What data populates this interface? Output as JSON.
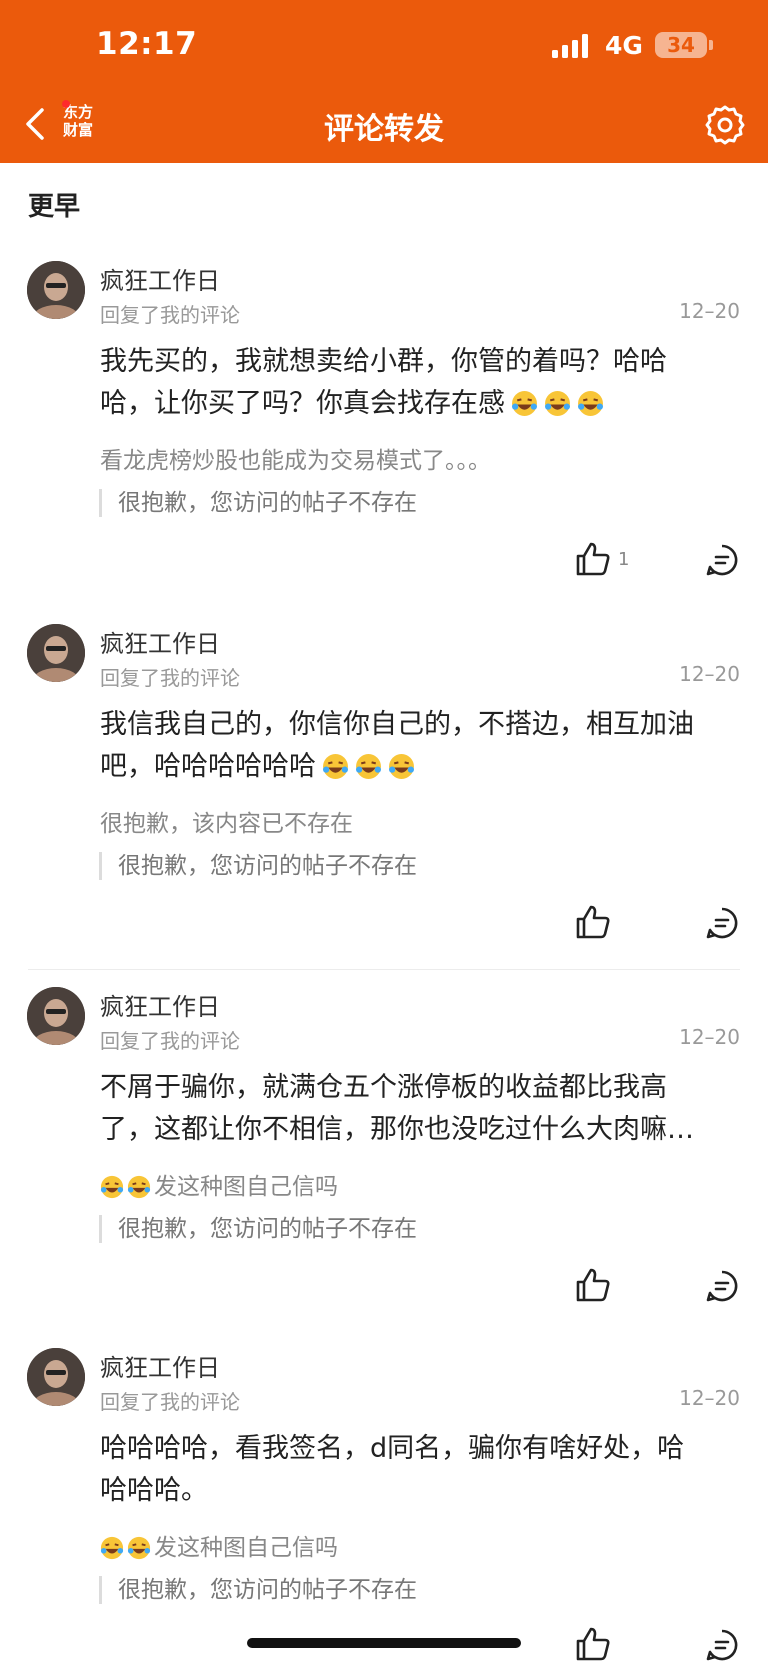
{
  "status_bar": {
    "time": "12:17",
    "network": "4G",
    "battery": "34"
  },
  "nav": {
    "title": "评论转发",
    "logo_line1": "东方",
    "logo_line2": "财富"
  },
  "section_title": "更早",
  "comments": [
    {
      "user": "疯狂工作日",
      "reply_label": "回复了我的评论",
      "date": "12–20",
      "text_line1": "我先买的，我就想卖给小群，你管的着吗？哈哈",
      "text_line2": "哈，让你买了吗？你真会找存在感",
      "original": "看龙虎榜炒股也能成为交易模式了。。。",
      "quote": "很抱歉，您访问的帖子不存在",
      "like_count": "1"
    },
    {
      "user": "疯狂工作日",
      "reply_label": "回复了我的评论",
      "date": "12–20",
      "text_line1": "我信我自己的，你信你自己的，不搭边，相互加油",
      "text_line2": "吧，哈哈哈哈哈哈",
      "original": "很抱歉，该内容已不存在",
      "quote": "很抱歉，您访问的帖子不存在",
      "like_count": ""
    },
    {
      "user": "疯狂工作日",
      "reply_label": "回复了我的评论",
      "date": "12–20",
      "text_line1": "不屑于骗你，就满仓五个涨停板的收益都比我高",
      "text_line2": "了，这都让你不相信，那你也没吃过什么大肉嘛…",
      "original": "发这种图自己信吗",
      "quote": "很抱歉，您访问的帖子不存在",
      "like_count": ""
    },
    {
      "user": "疯狂工作日",
      "reply_label": "回复了我的评论",
      "date": "12–20",
      "text_line1": "哈哈哈哈，看我签名，d同名，骗你有啥好处，哈",
      "text_line2": "哈哈哈。",
      "original": "发这种图自己信吗",
      "quote": "很抱歉，您访问的帖子不存在",
      "like_count": ""
    }
  ],
  "colors": {
    "brand": "#EB5A0C",
    "text": "#222222",
    "muted": "#999999"
  },
  "icons": [
    "back-icon",
    "gear-icon",
    "thumbs-up-icon",
    "comment-icon",
    "laugh-cry-emoji"
  ]
}
